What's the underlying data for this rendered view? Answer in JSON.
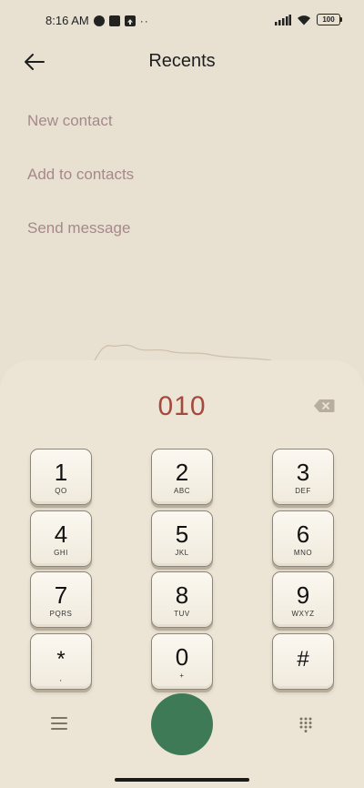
{
  "status_bar": {
    "time": "8:16 AM",
    "icons": [
      "notification-icon",
      "app-icon",
      "upload-icon",
      "more-icon",
      "signal-icon",
      "wifi-icon"
    ],
    "battery": "100"
  },
  "header": {
    "title": "Recents",
    "back_icon": "arrow-left-icon"
  },
  "menu": {
    "items": [
      {
        "label": "New contact"
      },
      {
        "label": "Add to contacts"
      },
      {
        "label": "Send message"
      }
    ]
  },
  "dialer": {
    "number": "010",
    "keys": [
      {
        "digit": "1",
        "letters": "QO"
      },
      {
        "digit": "2",
        "letters": "ABC"
      },
      {
        "digit": "3",
        "letters": "DEF"
      },
      {
        "digit": "4",
        "letters": "GHI"
      },
      {
        "digit": "5",
        "letters": "JKL"
      },
      {
        "digit": "6",
        "letters": "MNO"
      },
      {
        "digit": "7",
        "letters": "PQRS"
      },
      {
        "digit": "8",
        "letters": "TUV"
      },
      {
        "digit": "9",
        "letters": "WXYZ"
      },
      {
        "digit": "*",
        "letters": ","
      },
      {
        "digit": "0",
        "letters": "+"
      },
      {
        "digit": "#",
        "letters": ""
      }
    ],
    "call_color": "#3f7a57",
    "number_color": "#a34a3e"
  }
}
